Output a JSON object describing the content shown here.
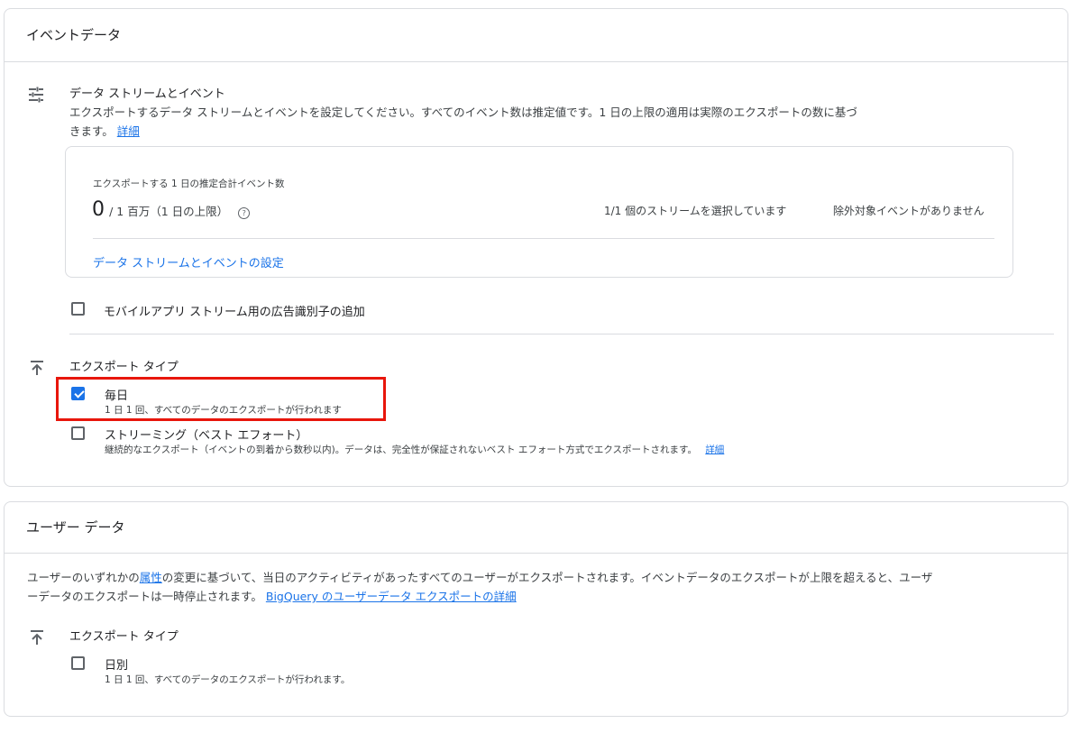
{
  "event_data": {
    "title": "イベントデータ",
    "streams": {
      "icon": "tune-sliders-icon",
      "title": "データ ストリームとイベント",
      "desc_line1": "エクスポートするデータ ストリームとイベントを設定してください。すべてのイベント数は推定値です。1 日の上限の適用は実際のエクスポートの数に基づ",
      "desc_line2": "きます。",
      "link": "詳細"
    },
    "summary": {
      "label": "エクスポートする 1 日の推定合計イベント数",
      "count": "0",
      "limit": "/ 1 百万（1 日の上限）",
      "streams_selected": "1/1 個のストリームを選択しています",
      "excluded": "除外対象イベントがありません",
      "config_link": "データ ストリームとイベントの設定"
    },
    "mobile_ads_checkbox": {
      "label": "モバイルアプリ ストリーム用の広告識別子の追加",
      "checked": false
    },
    "export_type": {
      "icon": "upload-icon",
      "title": "エクスポート タイプ",
      "daily": {
        "label": "毎日",
        "sub": "1 日 1 回、すべてのデータのエクスポートが行われます",
        "checked": true
      },
      "streaming": {
        "label": "ストリーミング（ベスト エフォート）",
        "sub": "継続的なエクスポート（イベントの到着から数秒以内)。データは、完全性が保証されないベスト エフォート方式でエクスポートされます。",
        "link": "詳細",
        "checked": false
      }
    }
  },
  "user_data": {
    "title": "ユーザー データ",
    "desc_pre": "ユーザーのいずれかの",
    "desc_link1": "属性",
    "desc_mid": "の変更に基づいて、当日のアクティビティがあったすべてのユーザーがエクスポートされます。イベントデータのエクスポートが上限を超えると、ユーザ",
    "desc_line2": "ーデータのエクスポートは一時停止されます。",
    "desc_link2": "BigQuery のユーザーデータ エクスポートの詳細",
    "export_type": {
      "icon": "upload-icon",
      "title": "エクスポート タイプ",
      "daily": {
        "label": "日別",
        "sub": "1 日 1 回、すべてのデータのエクスポートが行われます。",
        "checked": false
      }
    }
  },
  "colors": {
    "accent": "#1a73e8",
    "highlight": "#e8160c",
    "border": "#dadce0"
  }
}
